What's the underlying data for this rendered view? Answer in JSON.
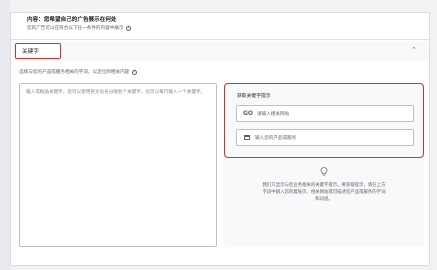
{
  "header": {
    "title": "内容：您希望自己的广告展示在何处",
    "subtitle": "您的广告可以在符合以下任一条件的内容中展示"
  },
  "keywords_section": {
    "tab_label": "关键字",
    "instruction": "选择与您的产品或服务相关的字词，以定位到相关内容",
    "input_placeholder": "输入或粘贴关键字。您可以使用英文逗号分隔各个关键字，也可以每行输入一个关键字。"
  },
  "suggestions": {
    "title": "获取关键字提示",
    "website_placeholder": "请输入相关网站",
    "product_placeholder": "输入您的产品或服务",
    "help_text": "我们只显示与您业务相关的关键字提示。要获取提示，请在上方字段中输入您的着陆页、相关网站或可描述您产品或服务的字词和词组。"
  },
  "icons": {
    "info": "info-icon",
    "collapse": "chevron-up-icon",
    "link": "link-icon",
    "store": "store-icon",
    "bulb": "lightbulb-icon"
  },
  "colors": {
    "highlight": "#d93025",
    "border": "#dadce0",
    "muted_text": "#5f6368"
  }
}
